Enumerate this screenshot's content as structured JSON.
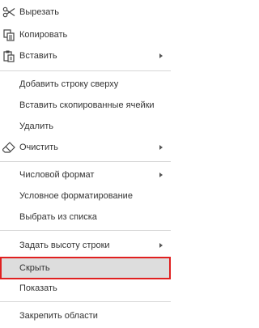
{
  "menu": {
    "items": [
      {
        "label": "Вырезать",
        "icon": "scissors-icon"
      },
      {
        "label": "Копировать",
        "icon": "copy-icon"
      },
      {
        "label": "Вставить",
        "icon": "paste-icon",
        "submenu": true
      },
      {
        "label": "Добавить строку сверху"
      },
      {
        "label": "Вставить скопированные ячейки"
      },
      {
        "label": "Удалить"
      },
      {
        "label": "Очистить",
        "icon": "eraser-icon",
        "submenu": true
      },
      {
        "label": "Числовой формат",
        "submenu": true
      },
      {
        "label": "Условное форматирование"
      },
      {
        "label": "Выбрать из списка"
      },
      {
        "label": "Задать высоту строки",
        "submenu": true
      },
      {
        "label": "Скрыть",
        "highlighted": true
      },
      {
        "label": "Показать"
      },
      {
        "label": "Закрепить области"
      }
    ]
  },
  "colors": {
    "text": "#333333",
    "separator": "#d7d7d7",
    "highlight_bg": "#dddddd",
    "highlight_border": "#e02020"
  }
}
